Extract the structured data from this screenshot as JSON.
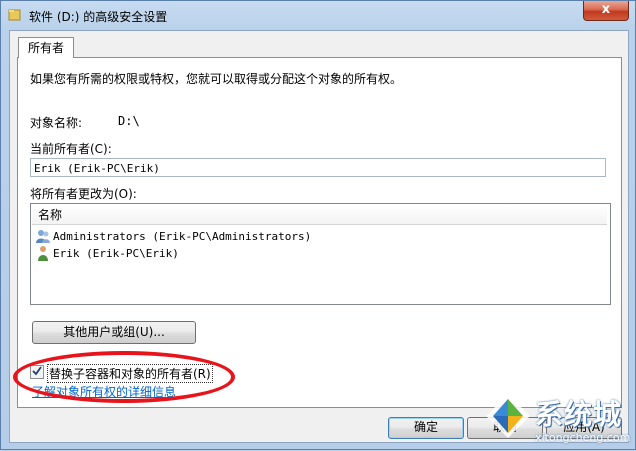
{
  "window": {
    "title": "软件 (D:) 的高级安全设置",
    "close_glyph": "x"
  },
  "tab": {
    "label": "所有者"
  },
  "description": "如果您有所需的权限或特权，您就可以取得或分配这个对象的所有权。",
  "object_name": {
    "label": "对象名称:",
    "value": "D:\\"
  },
  "current_owner": {
    "label": "当前所有者(C):",
    "value": "Erik (Erik-PC\\Erik)"
  },
  "change_owner": {
    "label": "将所有者更改为(O):",
    "column_header": "名称",
    "items": [
      {
        "label": "Administrators (Erik-PC\\Administrators)",
        "icon": "users-group-icon"
      },
      {
        "label": "Erik (Erik-PC\\Erik)",
        "icon": "user-icon"
      }
    ]
  },
  "other_users_button": "其他用户或组(U)...",
  "replace_checkbox": {
    "label": "替换子容器和对象的所有者(R)",
    "checked": true
  },
  "learn_more_link": "了解对象所有权的详细信息",
  "buttons": {
    "ok": "确定",
    "cancel": "取消",
    "apply": "应用(A)"
  },
  "watermark": {
    "text": "系统城",
    "url": "xitongcheng.com"
  },
  "colors": {
    "annotation": "#e8141c",
    "link": "#0066cc",
    "title_bar": "#b9d1ea"
  }
}
